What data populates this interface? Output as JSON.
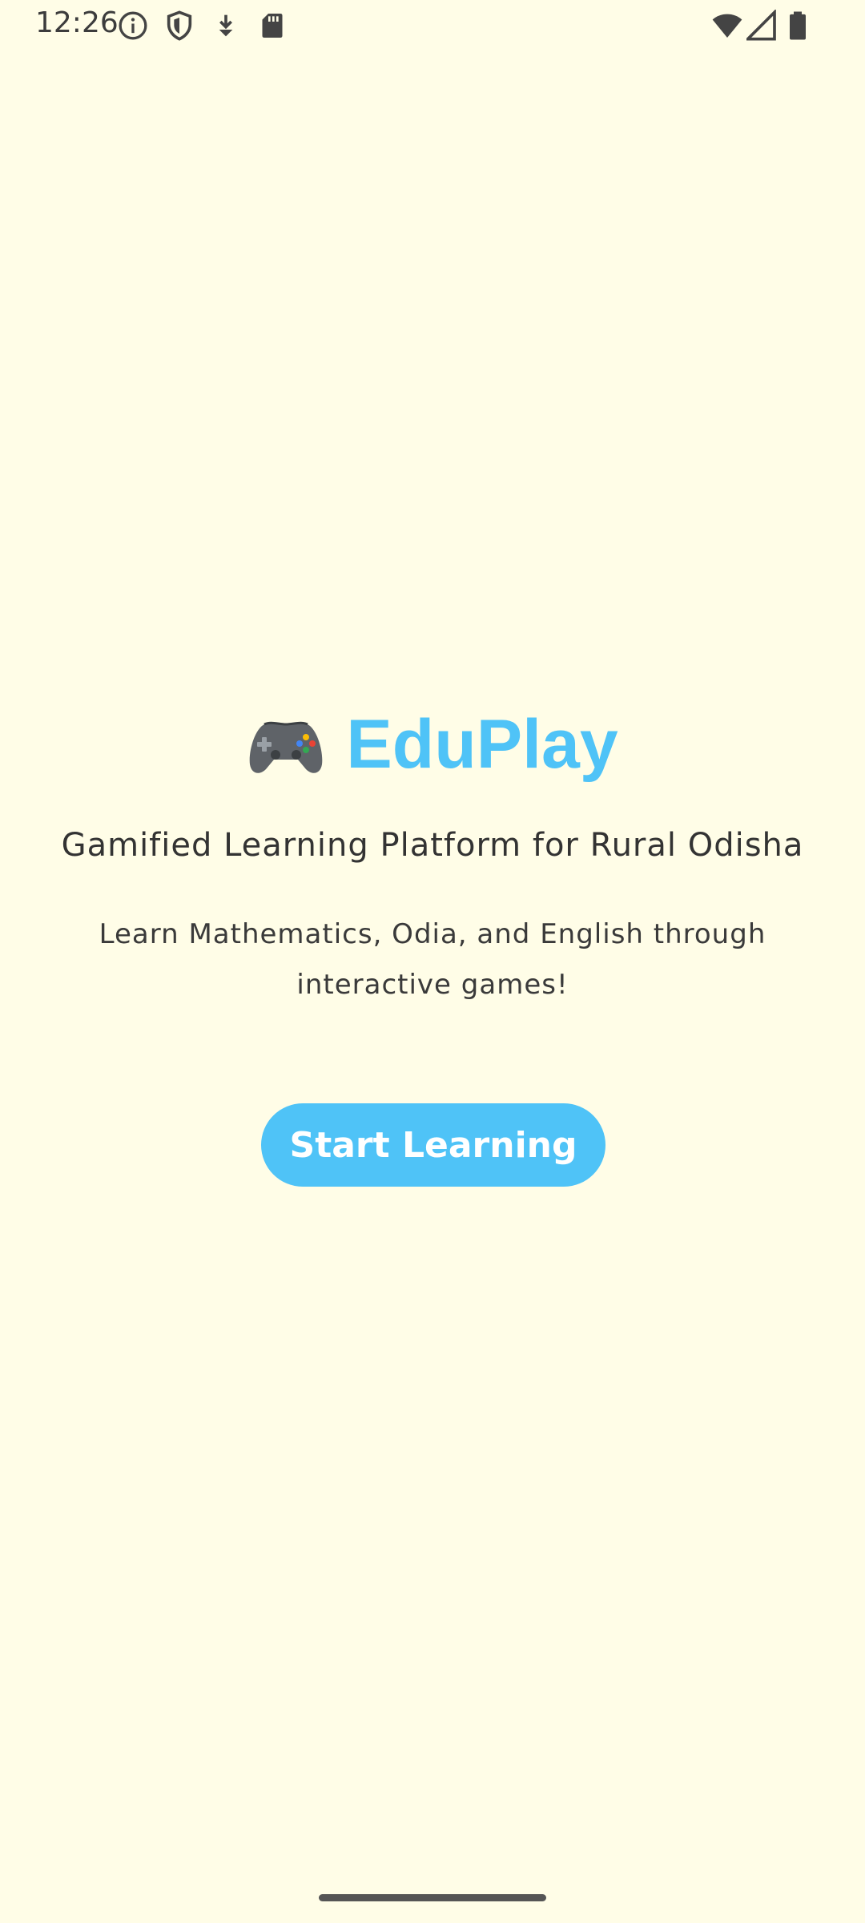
{
  "status_bar": {
    "time": "12:26",
    "left_icons": [
      "info-icon",
      "shield-icon",
      "download-icon",
      "sd-card-icon"
    ],
    "right_icons": [
      "wifi-icon",
      "signal-icon",
      "battery-icon"
    ]
  },
  "app": {
    "title_icon": "game-controller-icon",
    "title": "EduPlay",
    "subtitle": "Gamified Learning Platform for Rural Odisha",
    "description": "Learn Mathematics, Odia, and English through interactive games!",
    "start_button_label": "Start Learning"
  },
  "colors": {
    "background": "#fffde7",
    "accent": "#4fc3f7",
    "text": "#333333"
  }
}
